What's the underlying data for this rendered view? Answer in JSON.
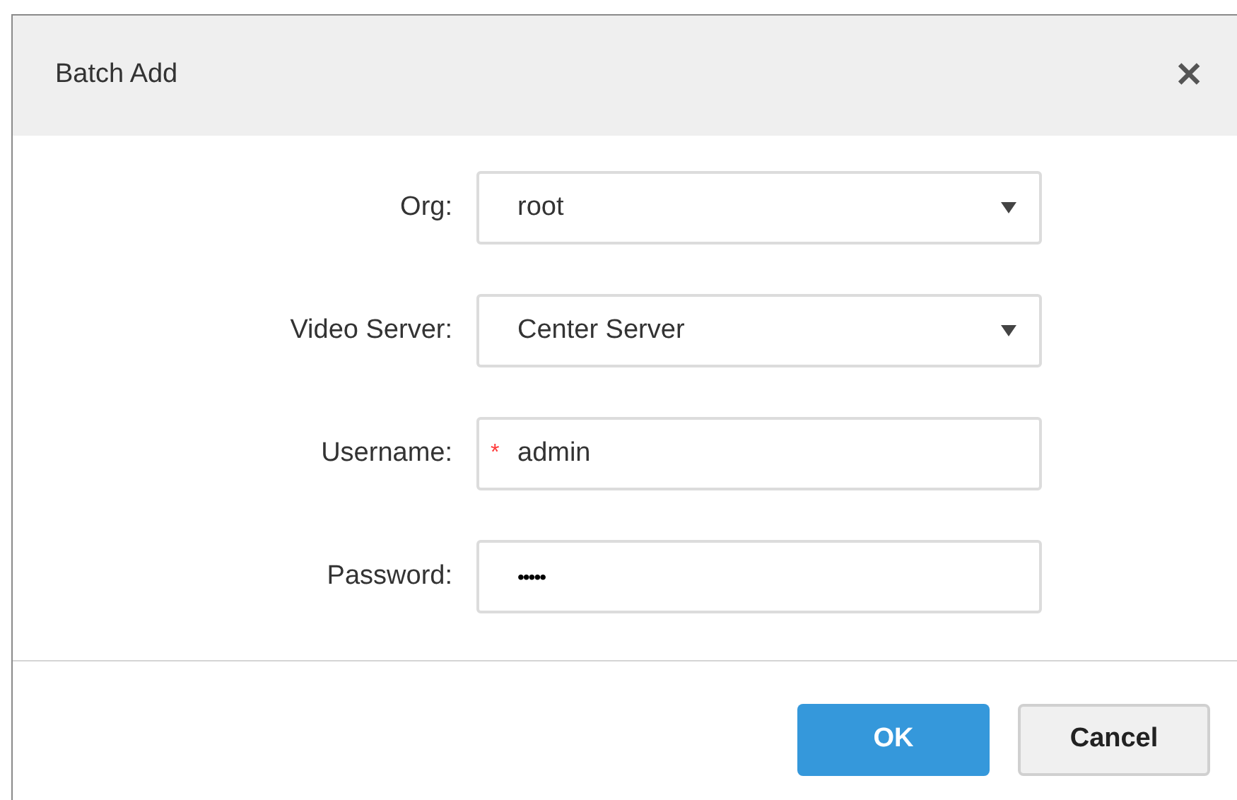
{
  "dialog": {
    "title": "Batch Add",
    "close": "✕"
  },
  "fields": [
    {
      "label": "Org:",
      "kind": "select",
      "value": "root"
    },
    {
      "label": "Video Server:",
      "kind": "select",
      "value": "Center Server"
    },
    {
      "label": "Username:",
      "kind": "text",
      "value": "admin",
      "required_marker": "*"
    },
    {
      "label": "Password:",
      "kind": "password",
      "value": "•••••"
    }
  ],
  "buttons": [
    {
      "label": "OK",
      "kind": "primary"
    },
    {
      "label": "Cancel",
      "kind": "secondary"
    }
  ]
}
